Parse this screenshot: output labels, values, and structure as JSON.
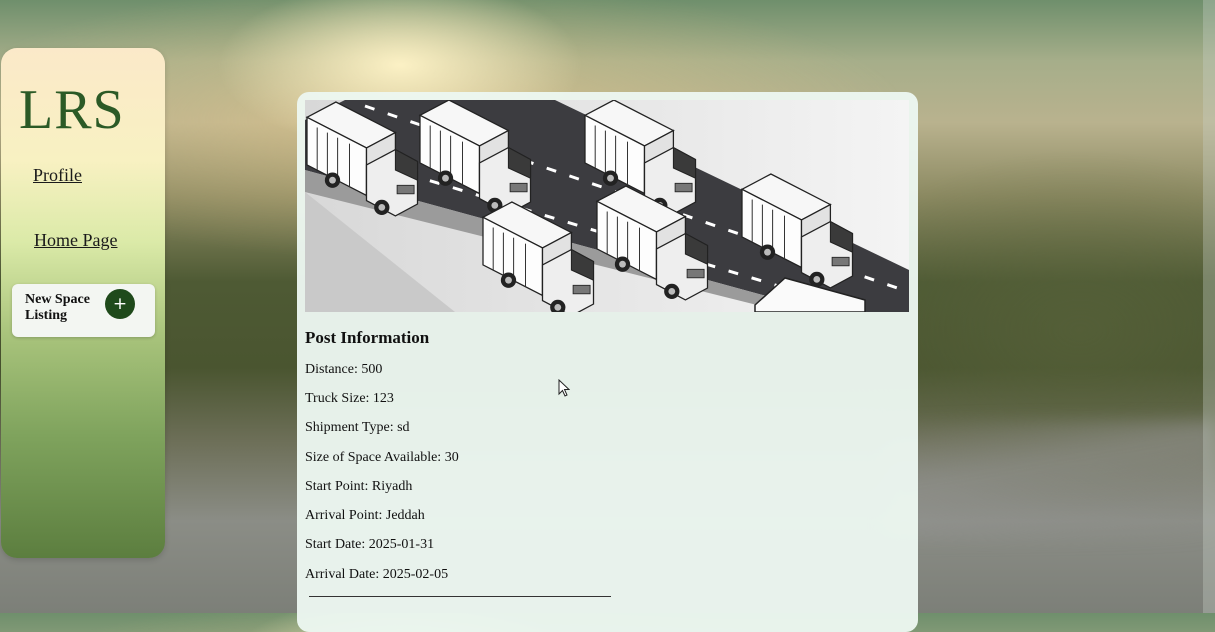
{
  "sidebar": {
    "logo": "LRS",
    "nav": {
      "profile": "Profile",
      "home": "Home Page"
    },
    "new_listing": {
      "label": "New Space Listing",
      "button_symbol": "+"
    }
  },
  "post": {
    "heading": "Post Information",
    "fields": [
      "Distance: 500",
      "Truck Size: 123",
      "Shipment Type: sd",
      "Size of Space Available: 30",
      "Start Point: Riyadh",
      "Arrival Point: Jeddah",
      "Start Date: 2025-01-31",
      "Arrival Date: 2025-02-05"
    ]
  },
  "colors": {
    "brand_green": "#2b5a26",
    "button_green": "#1f4a1b"
  },
  "icons": [
    "plus-icon",
    "mouse-pointer-icon",
    "truck-illustration"
  ]
}
